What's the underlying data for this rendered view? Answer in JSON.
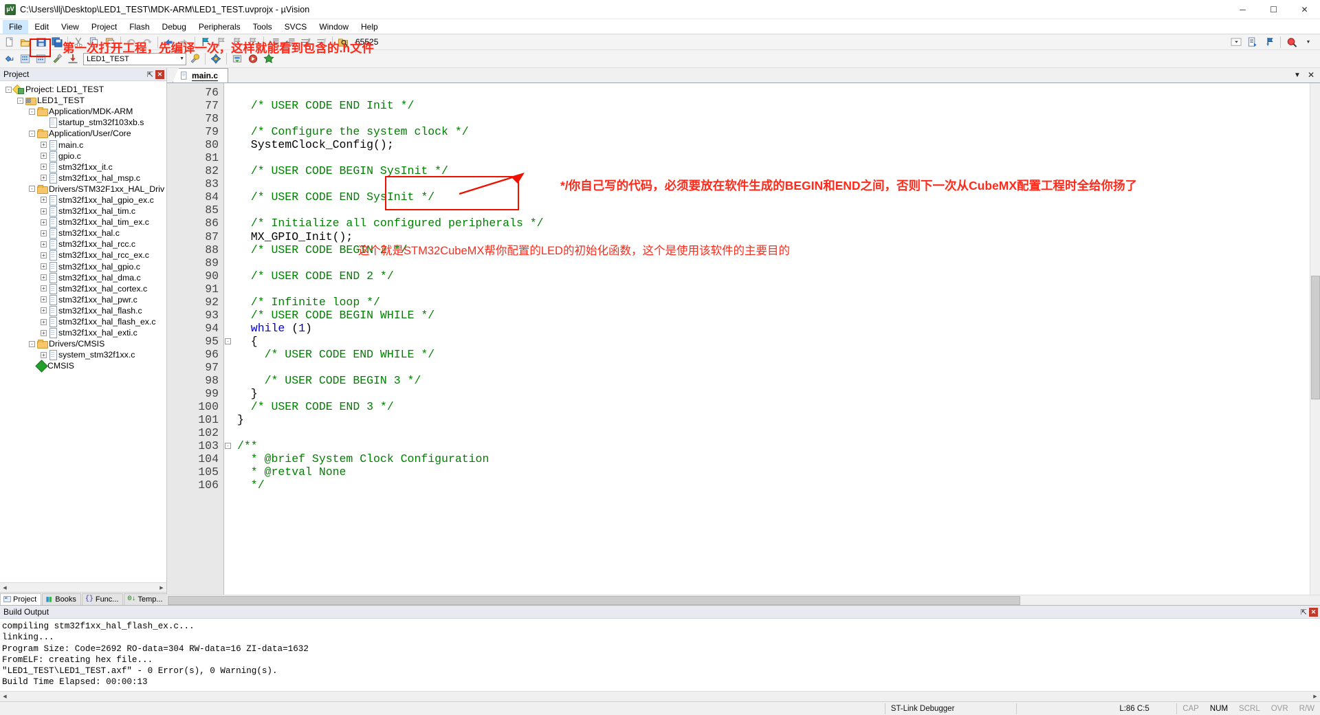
{
  "window": {
    "title": "C:\\Users\\llj\\Desktop\\LED1_TEST\\MDK-ARM\\LED1_TEST.uvprojx - µVision",
    "app_icon": "uvision-icon",
    "minimize": "─",
    "maximize": "☐",
    "close": "✕"
  },
  "menubar": {
    "items": [
      "File",
      "Edit",
      "View",
      "Project",
      "Flash",
      "Debug",
      "Peripherals",
      "Tools",
      "SVCS",
      "Window",
      "Help"
    ]
  },
  "toolbar1": {
    "buttons": [
      "new-file-icon",
      "open-file-icon",
      "save-icon",
      "save-all-icon",
      "cut-icon",
      "copy-icon",
      "paste-icon",
      "undo-icon",
      "redo-icon",
      "navigate-back-icon",
      "navigate-forward-icon",
      "bookmark-toggle-icon",
      "bookmark-prev-icon",
      "bookmark-next-icon",
      "bookmark-clear-icon",
      "indent-icon",
      "outdent-icon",
      "comment-icon",
      "uncomment-icon",
      "find-in-files-icon"
    ],
    "find_value": "65525",
    "right_buttons": [
      "configure-target-icon",
      "debug-settings-icon",
      "magnifier-icon"
    ]
  },
  "toolbar2": {
    "buttons": [
      "translate-icon",
      "build-icon",
      "rebuild-icon",
      "batch-build-icon",
      "download-icon"
    ],
    "target_value": "LED1_TEST",
    "right_buttons": [
      "target-options-icon",
      "manage-runtime-icon",
      "start-debug-icon",
      "pack-installer-icon",
      "configuration-wizard-icon"
    ]
  },
  "project_pane": {
    "header": "Project",
    "pin_icon": "pin-icon",
    "close_icon": "close-icon",
    "tree": [
      {
        "depth": 0,
        "expander": "-",
        "icon": "project-icon",
        "label": "Project: LED1_TEST"
      },
      {
        "depth": 1,
        "expander": "-",
        "icon": "target-icon",
        "label": "LED1_TEST"
      },
      {
        "depth": 2,
        "expander": "-",
        "icon": "folder-icon",
        "label": "Application/MDK-ARM"
      },
      {
        "depth": 3,
        "expander": "",
        "icon": "file-icon",
        "label": "startup_stm32f103xb.s"
      },
      {
        "depth": 2,
        "expander": "-",
        "icon": "folder-icon",
        "label": "Application/User/Core"
      },
      {
        "depth": 3,
        "expander": "+",
        "icon": "file-icon",
        "label": "main.c"
      },
      {
        "depth": 3,
        "expander": "+",
        "icon": "file-icon",
        "label": "gpio.c"
      },
      {
        "depth": 3,
        "expander": "+",
        "icon": "file-icon",
        "label": "stm32f1xx_it.c"
      },
      {
        "depth": 3,
        "expander": "+",
        "icon": "file-icon",
        "label": "stm32f1xx_hal_msp.c"
      },
      {
        "depth": 2,
        "expander": "-",
        "icon": "folder-icon",
        "label": "Drivers/STM32F1xx_HAL_Driv"
      },
      {
        "depth": 3,
        "expander": "+",
        "icon": "file-icon",
        "label": "stm32f1xx_hal_gpio_ex.c"
      },
      {
        "depth": 3,
        "expander": "+",
        "icon": "file-icon",
        "label": "stm32f1xx_hal_tim.c"
      },
      {
        "depth": 3,
        "expander": "+",
        "icon": "file-icon",
        "label": "stm32f1xx_hal_tim_ex.c"
      },
      {
        "depth": 3,
        "expander": "+",
        "icon": "file-icon",
        "label": "stm32f1xx_hal.c"
      },
      {
        "depth": 3,
        "expander": "+",
        "icon": "file-icon",
        "label": "stm32f1xx_hal_rcc.c"
      },
      {
        "depth": 3,
        "expander": "+",
        "icon": "file-icon",
        "label": "stm32f1xx_hal_rcc_ex.c"
      },
      {
        "depth": 3,
        "expander": "+",
        "icon": "file-icon",
        "label": "stm32f1xx_hal_gpio.c"
      },
      {
        "depth": 3,
        "expander": "+",
        "icon": "file-icon",
        "label": "stm32f1xx_hal_dma.c"
      },
      {
        "depth": 3,
        "expander": "+",
        "icon": "file-icon",
        "label": "stm32f1xx_hal_cortex.c"
      },
      {
        "depth": 3,
        "expander": "+",
        "icon": "file-icon",
        "label": "stm32f1xx_hal_pwr.c"
      },
      {
        "depth": 3,
        "expander": "+",
        "icon": "file-icon",
        "label": "stm32f1xx_hal_flash.c"
      },
      {
        "depth": 3,
        "expander": "+",
        "icon": "file-icon",
        "label": "stm32f1xx_hal_flash_ex.c"
      },
      {
        "depth": 3,
        "expander": "+",
        "icon": "file-icon",
        "label": "stm32f1xx_hal_exti.c"
      },
      {
        "depth": 2,
        "expander": "-",
        "icon": "folder-icon",
        "label": "Drivers/CMSIS"
      },
      {
        "depth": 3,
        "expander": "+",
        "icon": "file-icon",
        "label": "system_stm32f1xx.c"
      },
      {
        "depth": 2,
        "expander": "",
        "icon": "cmsis-icon",
        "label": "CMSIS"
      }
    ],
    "tabs": [
      {
        "label": "Project",
        "icon": "project-tab-icon",
        "active": true
      },
      {
        "label": "Books",
        "icon": "books-tab-icon",
        "active": false
      },
      {
        "label": "Func...",
        "icon": "functions-tab-icon",
        "active": false
      },
      {
        "label": "Temp...",
        "icon": "templates-tab-icon",
        "active": false
      }
    ]
  },
  "editor": {
    "tabs": [
      {
        "label": "main.c",
        "icon": "file-icon",
        "active": true
      }
    ],
    "tab_caret": "▼",
    "tab_close": "✕",
    "first_line": 76,
    "lines": [
      {
        "n": 76,
        "fold": "",
        "segs": []
      },
      {
        "n": 77,
        "fold": "",
        "segs": [
          {
            "t": "  /* USER CODE END Init */",
            "c": "comment"
          }
        ]
      },
      {
        "n": 78,
        "fold": "",
        "segs": []
      },
      {
        "n": 79,
        "fold": "",
        "segs": [
          {
            "t": "  /* Configure the system clock */",
            "c": "comment"
          }
        ]
      },
      {
        "n": 80,
        "fold": "",
        "segs": [
          {
            "t": "  SystemClock_Config();",
            "c": "plain"
          }
        ]
      },
      {
        "n": 81,
        "fold": "",
        "segs": []
      },
      {
        "n": 82,
        "fold": "",
        "segs": [
          {
            "t": "  /* USER CODE BEGIN SysInit */",
            "c": "comment"
          }
        ]
      },
      {
        "n": 83,
        "fold": "",
        "segs": []
      },
      {
        "n": 84,
        "fold": "",
        "segs": [
          {
            "t": "  /* USER CODE END SysInit */",
            "c": "comment"
          }
        ]
      },
      {
        "n": 85,
        "fold": "",
        "segs": []
      },
      {
        "n": 86,
        "fold": "",
        "segs": [
          {
            "t": "  /* Initialize all configured peripherals */",
            "c": "comment"
          }
        ]
      },
      {
        "n": 87,
        "fold": "",
        "segs": [
          {
            "t": "  MX_GPIO_Init();",
            "c": "plain"
          }
        ]
      },
      {
        "n": 88,
        "fold": "",
        "segs": [
          {
            "t": "  /* USER CODE BEGIN 2 */",
            "c": "comment"
          }
        ]
      },
      {
        "n": 89,
        "fold": "",
        "segs": []
      },
      {
        "n": 90,
        "fold": "",
        "segs": [
          {
            "t": "  /* USER CODE END 2 */",
            "c": "comment"
          }
        ]
      },
      {
        "n": 91,
        "fold": "",
        "segs": []
      },
      {
        "n": 92,
        "fold": "",
        "segs": [
          {
            "t": "  /* Infinite loop */",
            "c": "comment"
          }
        ]
      },
      {
        "n": 93,
        "fold": "",
        "segs": [
          {
            "t": "  /* USER CODE BEGIN WHILE */",
            "c": "comment"
          }
        ]
      },
      {
        "n": 94,
        "fold": "",
        "segs": [
          {
            "t": "  while",
            "c": "kw"
          },
          {
            "t": " (",
            "c": "plain"
          },
          {
            "t": "1",
            "c": "kw"
          },
          {
            "t": ")",
            "c": "plain"
          }
        ]
      },
      {
        "n": 95,
        "fold": "-",
        "segs": [
          {
            "t": "  {",
            "c": "plain"
          }
        ]
      },
      {
        "n": 96,
        "fold": "",
        "segs": [
          {
            "t": "    /* USER CODE END WHILE */",
            "c": "comment"
          }
        ]
      },
      {
        "n": 97,
        "fold": "",
        "segs": []
      },
      {
        "n": 98,
        "fold": "",
        "segs": [
          {
            "t": "    /* USER CODE BEGIN 3 */",
            "c": "comment"
          }
        ]
      },
      {
        "n": 99,
        "fold": "",
        "segs": [
          {
            "t": "  }",
            "c": "plain"
          }
        ]
      },
      {
        "n": 100,
        "fold": "",
        "segs": [
          {
            "t": "  /* USER CODE END 3 */",
            "c": "comment"
          }
        ]
      },
      {
        "n": 101,
        "fold": "",
        "segs": [
          {
            "t": "}",
            "c": "plain"
          }
        ]
      },
      {
        "n": 102,
        "fold": "",
        "segs": []
      },
      {
        "n": 103,
        "fold": "-",
        "segs": [
          {
            "t": "/**",
            "c": "comment"
          }
        ]
      },
      {
        "n": 104,
        "fold": "",
        "segs": [
          {
            "t": "  * @brief System Clock Configuration",
            "c": "comment"
          }
        ]
      },
      {
        "n": 105,
        "fold": "",
        "segs": [
          {
            "t": "  * @retval None",
            "c": "comment"
          }
        ]
      },
      {
        "n": 106,
        "fold": "",
        "segs": [
          {
            "t": "  */",
            "c": "comment"
          }
        ]
      }
    ]
  },
  "annotations": {
    "toolbar_note": "第一次打开工程，先编译一次，这样就能看到包含的.h文件",
    "sysinit_note": "*/你自己写的代码，必须要放在软件生成的BEGIN和END之间，否则下一次从CubeMX配置工程时全给你扬了",
    "gpio_init_note": "这个就是STM32CubeMX帮你配置的LED的初始化函数，这个是使用该软件的主要目的",
    "highlight_color": "#f01000",
    "text_color": "#ff2a1a"
  },
  "build_output": {
    "header": "Build Output",
    "lines": [
      "compiling stm32f1xx_hal_flash_ex.c...",
      "linking...",
      "Program Size: Code=2692 RO-data=304 RW-data=16 ZI-data=1632",
      "FromELF: creating hex file...",
      "\"LED1_TEST\\LED1_TEST.axf\" - 0 Error(s), 0 Warning(s).",
      "Build Time Elapsed:  00:00:13"
    ],
    "pin_icon": "pin-icon",
    "close_icon": "close-icon"
  },
  "statusbar": {
    "debugger": "ST-Link Debugger",
    "cursor": "L:86 C:5",
    "indicators": [
      {
        "label": "CAP",
        "active": false
      },
      {
        "label": "NUM",
        "active": true
      },
      {
        "label": "SCRL",
        "active": false
      },
      {
        "label": "OVR",
        "active": false
      },
      {
        "label": "R/W",
        "active": false
      }
    ]
  }
}
